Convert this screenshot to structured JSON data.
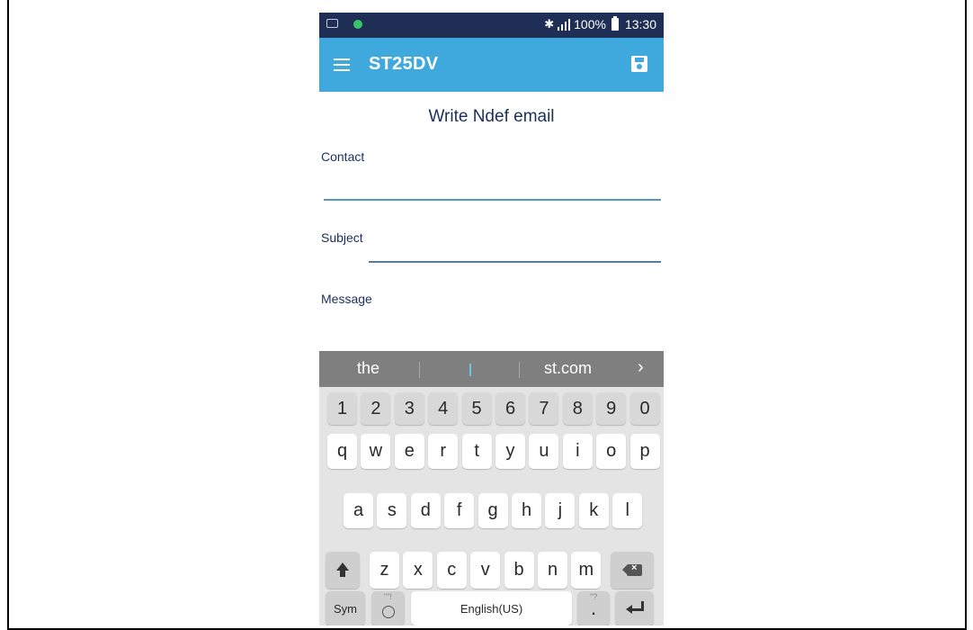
{
  "status_bar": {
    "battery": "100%",
    "time": "13:30",
    "icons": [
      "keyboard-icon",
      "app-notification-dot-icon",
      "bluetooth-icon",
      "signal-icon",
      "battery-icon"
    ]
  },
  "app_bar": {
    "title": "ST25DV",
    "menu_icon": "hamburger-menu-icon",
    "action_icon": "save-icon"
  },
  "form": {
    "title": "Write Ndef email",
    "contact_label": "Contact",
    "subject_label": "Subject",
    "message_label": "Message"
  },
  "suggestions": {
    "left": "the",
    "right": "st.com",
    "more": "›"
  },
  "keyboard": {
    "numbers": [
      "1",
      "2",
      "3",
      "4",
      "5",
      "6",
      "7",
      "8",
      "9",
      "0"
    ],
    "row1": [
      "q",
      "w",
      "e",
      "r",
      "t",
      "y",
      "u",
      "i",
      "o",
      "p"
    ],
    "row2": [
      "a",
      "s",
      "d",
      "f",
      "g",
      "h",
      "j",
      "k",
      "l"
    ],
    "row3": [
      "z",
      "x",
      "c",
      "v",
      "b",
      "n",
      "m"
    ],
    "sym_label": "Sym",
    "space_label": "English(US)",
    "period_label": ".",
    "emoji_hint": "\"\"!",
    "period_hint": "\"?"
  }
}
